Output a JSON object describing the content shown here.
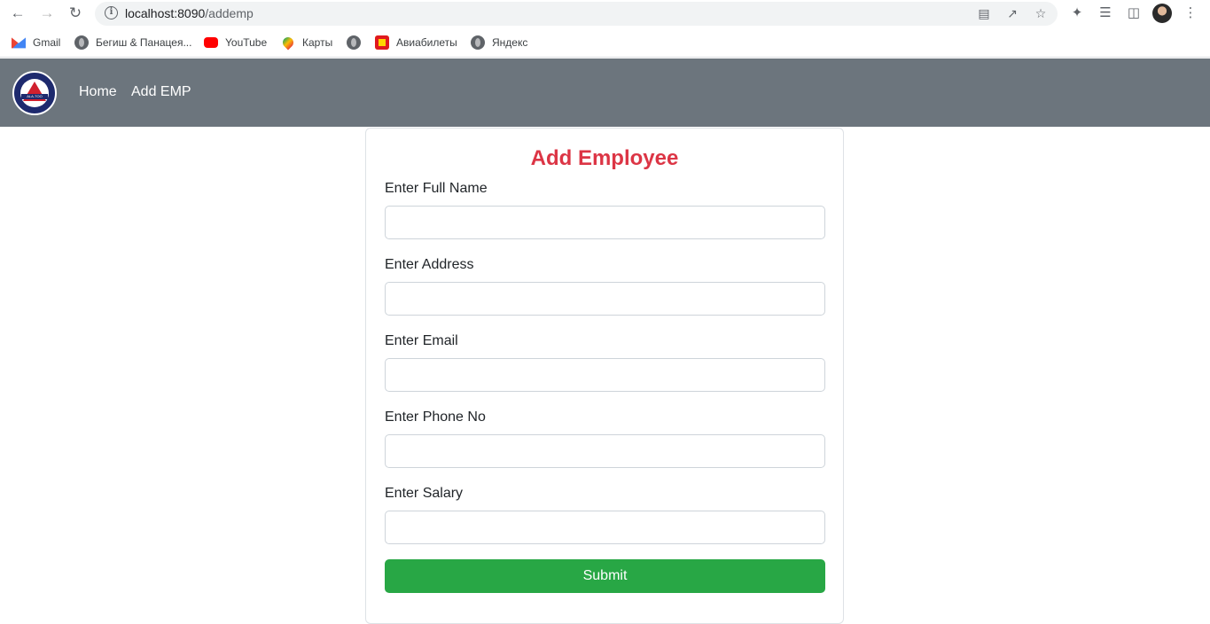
{
  "browser": {
    "url_host": "localhost:8090",
    "url_path": "/addemp",
    "bookmarks": [
      {
        "label": "Gmail",
        "icon": "gmail-icon"
      },
      {
        "label": "Бегиш & Панацея...",
        "icon": "globe-icon"
      },
      {
        "label": "YouTube",
        "icon": "youtube-icon"
      },
      {
        "label": "Карты",
        "icon": "maps-icon"
      },
      {
        "label": "",
        "icon": "globe-icon"
      },
      {
        "label": "Авиабилеты",
        "icon": "aviabilety-icon"
      },
      {
        "label": "Яндекс",
        "icon": "globe-icon"
      }
    ]
  },
  "navbar": {
    "logo_text": "ALA-TOO",
    "links": [
      {
        "label": "Home"
      },
      {
        "label": "Add EMP"
      }
    ],
    "background": "#6c757d"
  },
  "form": {
    "title": "Add Employee",
    "title_color": "#dc3545",
    "fields": [
      {
        "label": "Enter Full Name",
        "value": ""
      },
      {
        "label": "Enter Address",
        "value": ""
      },
      {
        "label": "Enter Email",
        "value": ""
      },
      {
        "label": "Enter Phone No",
        "value": ""
      },
      {
        "label": "Enter Salary",
        "value": ""
      }
    ],
    "submit_label": "Submit",
    "submit_color": "#28a745"
  }
}
